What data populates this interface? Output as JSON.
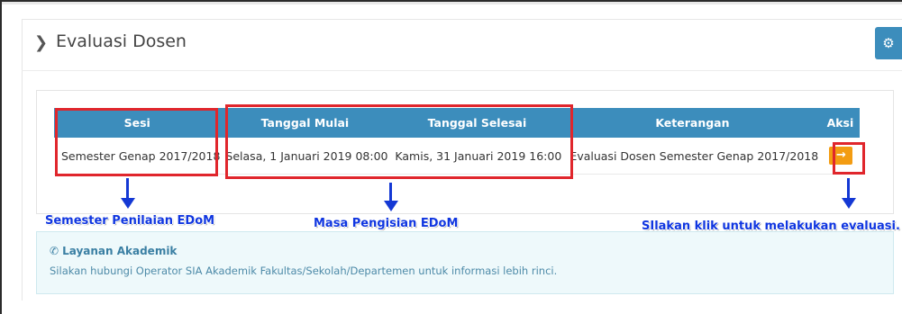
{
  "header": {
    "title": "Evaluasi Dosen"
  },
  "table": {
    "columns": [
      "Sesi",
      "Tanggal Mulai",
      "Tanggal Selesai",
      "Keterangan",
      "Aksi"
    ],
    "row": {
      "sesi": "Semester Genap 2017/2018",
      "tanggal_mulai": "Selasa, 1 Januari 2019 08:00",
      "tanggal_selesai": "Kamis, 31 Januari 2019 16:00",
      "keterangan": "Evaluasi Dosen Semester Genap 2017/2018",
      "aksi_icon": "→"
    }
  },
  "annotations": {
    "semester": "Semester Penilaian EDoM",
    "masa": "Masa Pengisian EDoM",
    "klik": "SIlakan klik untuk melakukan evaluasi."
  },
  "info": {
    "title": "Layanan Akademik",
    "text": "Silakan hubungi Operator SIA Akademik Fakultas/Sekolah/Departemen untuk informasi lebih rinci."
  },
  "colors": {
    "header_bg": "#3c8dbc",
    "action_button": "#f39c12",
    "annotation_box": "#e0262c",
    "annotation_text": "#1036e0"
  }
}
